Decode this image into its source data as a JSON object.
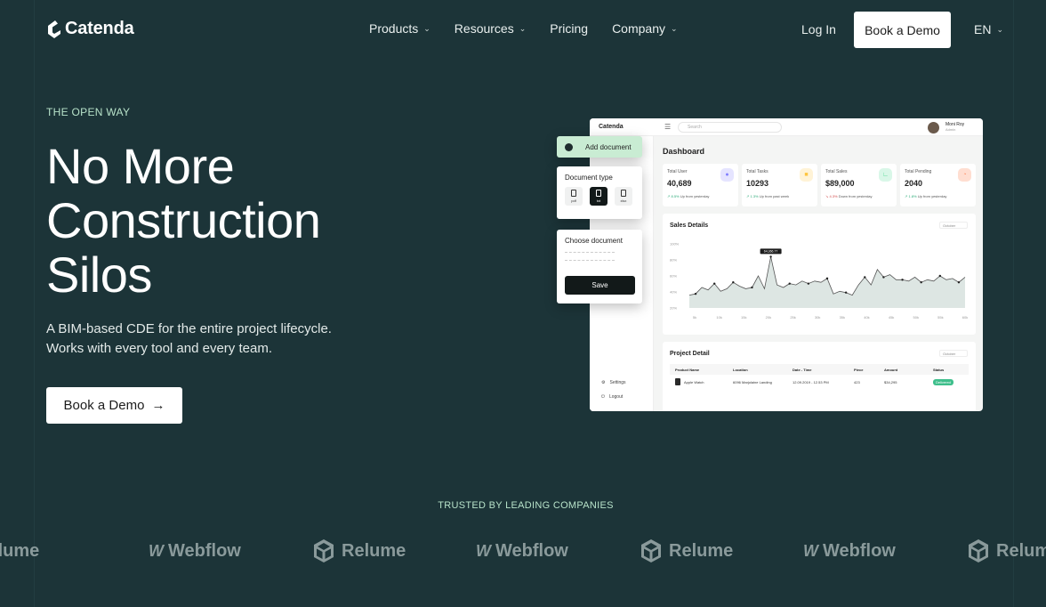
{
  "nav": {
    "logo_text": "Catenda",
    "menu": [
      {
        "label": "Products",
        "has_dropdown": true
      },
      {
        "label": "Resources",
        "has_dropdown": true
      },
      {
        "label": "Pricing",
        "has_dropdown": false
      },
      {
        "label": "Company",
        "has_dropdown": true
      }
    ],
    "login_label": "Log In",
    "demo_label": "Book a Demo",
    "lang_label": "EN"
  },
  "hero": {
    "eyebrow": "THE OPEN WAY",
    "headline": "No More Construction Silos",
    "sub_line1": "A BIM-based CDE for the entire project lifecycle.",
    "sub_line2": "Works with every tool and every team.",
    "cta_label": "Book a Demo",
    "cta_icon": "arrow-right-icon"
  },
  "mockup": {
    "brand": "Catenda",
    "search_placeholder": "Search",
    "user_name": "Moni Roy",
    "user_role": "Admin",
    "title": "Dashboard",
    "cards": [
      {
        "label": "Total User",
        "value": "40,689",
        "trend": "8.5%",
        "trend_text": "Up from yesterday",
        "dir": "up",
        "icon_color": "#e5e4ff",
        "glyph_color": "#8280ff"
      },
      {
        "label": "Total Tasks",
        "value": "10293",
        "trend": "1.3%",
        "trend_text": "Up from past week",
        "dir": "up",
        "icon_color": "#fff3d6",
        "glyph_color": "#fec53d"
      },
      {
        "label": "Total Sales",
        "value": "$89,000",
        "trend": "4.3%",
        "trend_text": "Down from yesterday",
        "dir": "down",
        "icon_color": "#d9f7e8",
        "glyph_color": "#4ad991"
      },
      {
        "label": "Total Pending",
        "value": "2040",
        "trend": "1.8%",
        "trend_text": "Up from yesterday",
        "dir": "up",
        "icon_color": "#ffded1",
        "glyph_color": "#ff9066"
      }
    ],
    "sales_title": "Sales Details",
    "sales_select": "October",
    "sales_tooltip": "64,366.77",
    "sales_yticks": [
      "100%",
      "80%",
      "60%",
      "40%",
      "20%"
    ],
    "sales_xticks": [
      "5k",
      "10k",
      "15k",
      "20k",
      "25k",
      "30k",
      "35k",
      "40k",
      "45k",
      "50k",
      "55k",
      "60k"
    ],
    "sales_series": [
      20,
      22,
      32,
      28,
      38,
      26,
      30,
      40,
      34,
      30,
      32,
      50,
      30,
      80,
      36,
      32,
      38,
      36,
      42,
      38,
      42,
      40,
      46,
      22,
      26,
      24,
      20,
      36,
      48,
      36,
      60,
      48,
      52,
      44,
      44,
      42,
      48,
      40,
      44,
      42,
      50,
      44,
      46,
      40,
      48
    ],
    "project_title": "Project Detail",
    "project_select": "October",
    "table_headers": [
      "Product Name",
      "Location",
      "Date - Time",
      "Piece",
      "Amount",
      "Status"
    ],
    "table_row": [
      "Apple Watch",
      "6096 Marjolaine Landing",
      "12.09.2019 - 12.53 PM",
      "423",
      "$34,295",
      "Delivered"
    ],
    "side_links": [
      "Settings",
      "Logout"
    ]
  },
  "floating": {
    "add_document": "Add document",
    "doc_type_title": "Document type",
    "file_types": [
      {
        "label": "pdf",
        "active": false
      },
      {
        "label": "txt",
        "active": true
      },
      {
        "label": "xlsx",
        "active": false
      }
    ],
    "choose_title": "Choose document",
    "save_label": "Save"
  },
  "trusted": {
    "label": "TRUSTED BY LEADING COMPANIES",
    "logos": [
      "Relume",
      "Webflow",
      "Relume",
      "Webflow",
      "Relume",
      "Webflow",
      "Relume"
    ]
  }
}
